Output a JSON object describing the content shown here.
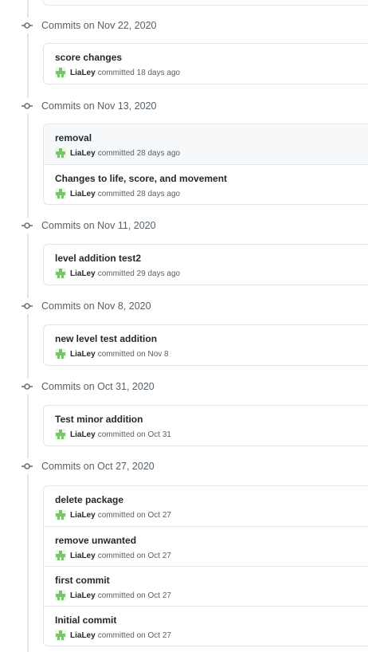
{
  "groups": [
    {
      "title": "Commits on Nov 22, 2020",
      "commits": [
        {
          "message": "score changes",
          "author": "LiaLey",
          "when": "committed 18 days ago"
        }
      ]
    },
    {
      "title": "Commits on Nov 13, 2020",
      "commits": [
        {
          "message": "removal",
          "author": "LiaLey",
          "when": "committed 28 days ago"
        },
        {
          "message": "Changes to life, score, and movement",
          "author": "LiaLey",
          "when": "committed 28 days ago"
        }
      ]
    },
    {
      "title": "Commits on Nov 11, 2020",
      "commits": [
        {
          "message": "level addition test2",
          "author": "LiaLey",
          "when": "committed 29 days ago"
        }
      ]
    },
    {
      "title": "Commits on Nov 8, 2020",
      "commits": [
        {
          "message": "new level test addition",
          "author": "LiaLey",
          "when": "committed on Nov 8"
        }
      ]
    },
    {
      "title": "Commits on Oct 31, 2020",
      "commits": [
        {
          "message": "Test minor addition",
          "author": "LiaLey",
          "when": "committed on Oct 31"
        }
      ]
    },
    {
      "title": "Commits on Oct 27, 2020",
      "commits": [
        {
          "message": "delete package",
          "author": "LiaLey",
          "when": "committed on Oct 27"
        },
        {
          "message": "remove unwanted",
          "author": "LiaLey",
          "when": "committed on Oct 27"
        },
        {
          "message": "first commit",
          "author": "LiaLey",
          "when": "committed on Oct 27"
        },
        {
          "message": "Initial commit",
          "author": "LiaLey",
          "when": "committed on Oct 27"
        }
      ]
    }
  ],
  "icons": {
    "group": "git-commit-icon",
    "avatar": "avatar-identicon"
  },
  "colors": {
    "timeline": "#e1e4e8",
    "avatar_green": "#79c46b",
    "highlight_row": "#f6f8fa"
  }
}
